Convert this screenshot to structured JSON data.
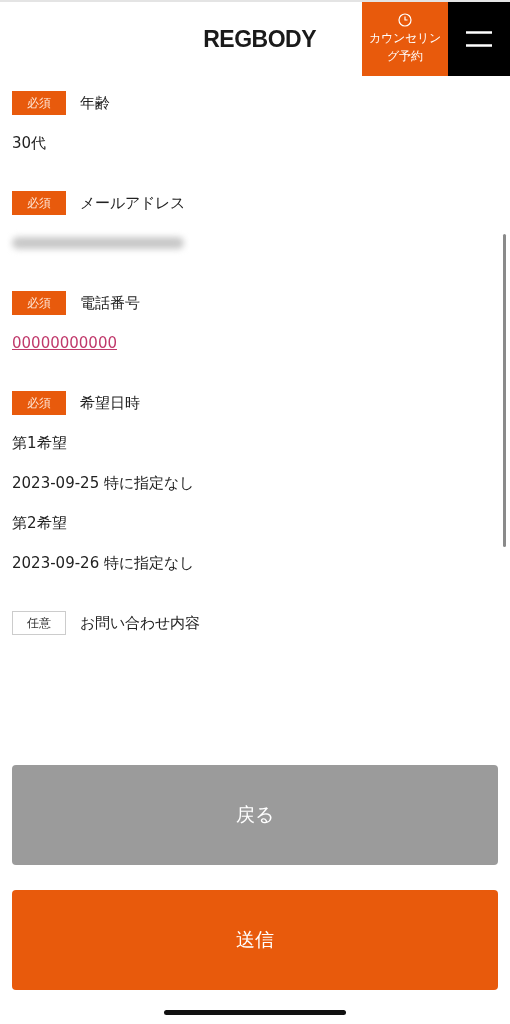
{
  "header": {
    "logo": "REGBODY",
    "booking_button": "カウンセリング予約"
  },
  "fields": [
    {
      "tag": "必須",
      "kind": "required",
      "label": "年齢",
      "values": [
        {
          "kind": "text",
          "text": "30代"
        }
      ]
    },
    {
      "tag": "必須",
      "kind": "required",
      "label": "メールアドレス",
      "values": [
        {
          "kind": "blurred"
        }
      ]
    },
    {
      "tag": "必須",
      "kind": "required",
      "label": "電話番号",
      "values": [
        {
          "kind": "link",
          "text": "00000000000"
        }
      ]
    },
    {
      "tag": "必須",
      "kind": "required",
      "label": "希望日時",
      "values": [
        {
          "kind": "text",
          "text": "第1希望"
        },
        {
          "kind": "text",
          "text": "2023-09-25 特に指定なし"
        },
        {
          "kind": "text",
          "text": "第2希望"
        },
        {
          "kind": "text",
          "text": "2023-09-26 特に指定なし"
        }
      ]
    },
    {
      "tag": "任意",
      "kind": "optional",
      "label": "お問い合わせ内容"
    }
  ],
  "buttons": [
    {
      "kind": "back",
      "label": "戻る"
    },
    {
      "kind": "submit",
      "label": "送信"
    }
  ]
}
